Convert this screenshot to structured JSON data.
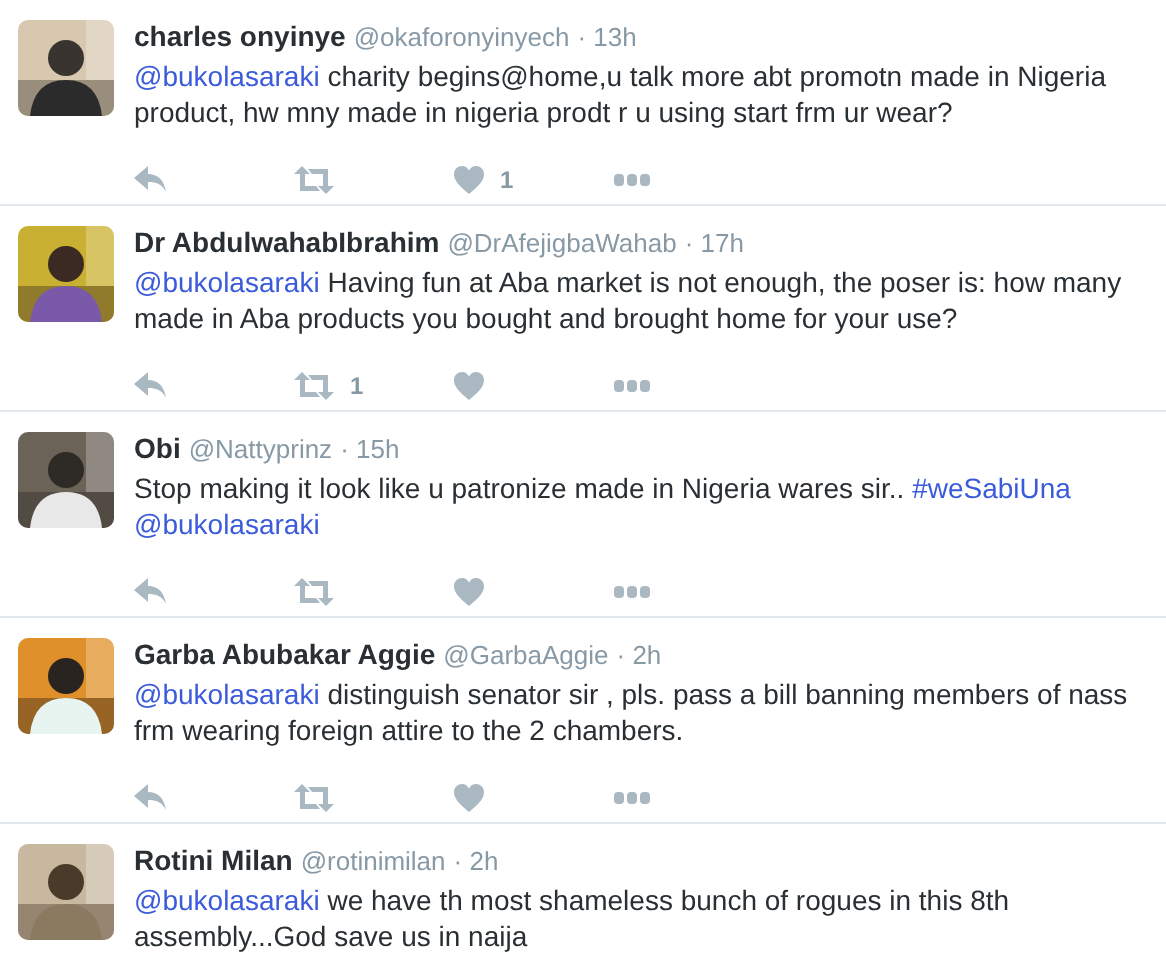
{
  "tweets": [
    {
      "name": "charles onyinye",
      "handle": "@okaforonyinyech",
      "time": "· 13h",
      "avatar": {
        "kind": "picture"
      },
      "body": [
        {
          "kind": "mention",
          "text": "@bukolasaraki"
        },
        {
          "kind": "plain",
          "text": " charity begins@home,u talk more abt promotn made in Nigeria product, hw mny made in nigeria prodt r u using start frm ur wear?"
        }
      ],
      "actions": [
        {
          "kind": "reply"
        },
        {
          "kind": "retweet"
        },
        {
          "kind": "like",
          "count": "1"
        },
        {
          "kind": "more"
        }
      ]
    },
    {
      "name": "Dr AbdulwahabIbrahim",
      "handle": "@DrAfejigbaWahab",
      "time": "· 17h",
      "avatar": {
        "kind": "picture"
      },
      "body": [
        {
          "kind": "mention",
          "text": "@bukolasaraki"
        },
        {
          "kind": "plain",
          "text": " Having fun at Aba market is not enough, the poser is: how many made in Aba products you bought and brought home for your use?"
        }
      ],
      "actions": [
        {
          "kind": "reply"
        },
        {
          "kind": "retweet",
          "count": "1"
        },
        {
          "kind": "like"
        },
        {
          "kind": "more"
        }
      ]
    },
    {
      "name": "Obi",
      "handle": "@Nattyprinz",
      "time": "· 15h",
      "avatar": {
        "kind": "picture"
      },
      "body": [
        {
          "kind": "plain",
          "text": "Stop making it look like u patronize made in Nigeria wares sir.. "
        },
        {
          "kind": "hashtag",
          "text": "#weSabiUna"
        },
        {
          "kind": "mention",
          "text": "@bukolasaraki"
        }
      ],
      "actions": [
        {
          "kind": "reply"
        },
        {
          "kind": "retweet"
        },
        {
          "kind": "like"
        },
        {
          "kind": "more"
        }
      ]
    },
    {
      "name": "Garba Abubakar Aggie",
      "handle": "@GarbaAggie",
      "time": "· 2h",
      "avatar": {
        "kind": "picture"
      },
      "body": [
        {
          "kind": "mention",
          "text": "@bukolasaraki"
        },
        {
          "kind": "plain",
          "text": " distinguish senator sir , pls. pass a bill banning members of nass frm wearing foreign attire to the 2 chambers."
        }
      ],
      "actions": [
        {
          "kind": "reply"
        },
        {
          "kind": "retweet"
        },
        {
          "kind": "like"
        },
        {
          "kind": "more"
        }
      ]
    },
    {
      "name": "Rotini Milan",
      "handle": "@rotinimilan",
      "time": "· 2h",
      "avatar": {
        "kind": "picture"
      },
      "body": [
        {
          "kind": "mention",
          "text": "@bukolasaraki"
        },
        {
          "kind": "plain",
          "text": " we have th most shameless bunch of rogues in this 8th assembly...God save us in naija"
        }
      ]
    }
  ]
}
